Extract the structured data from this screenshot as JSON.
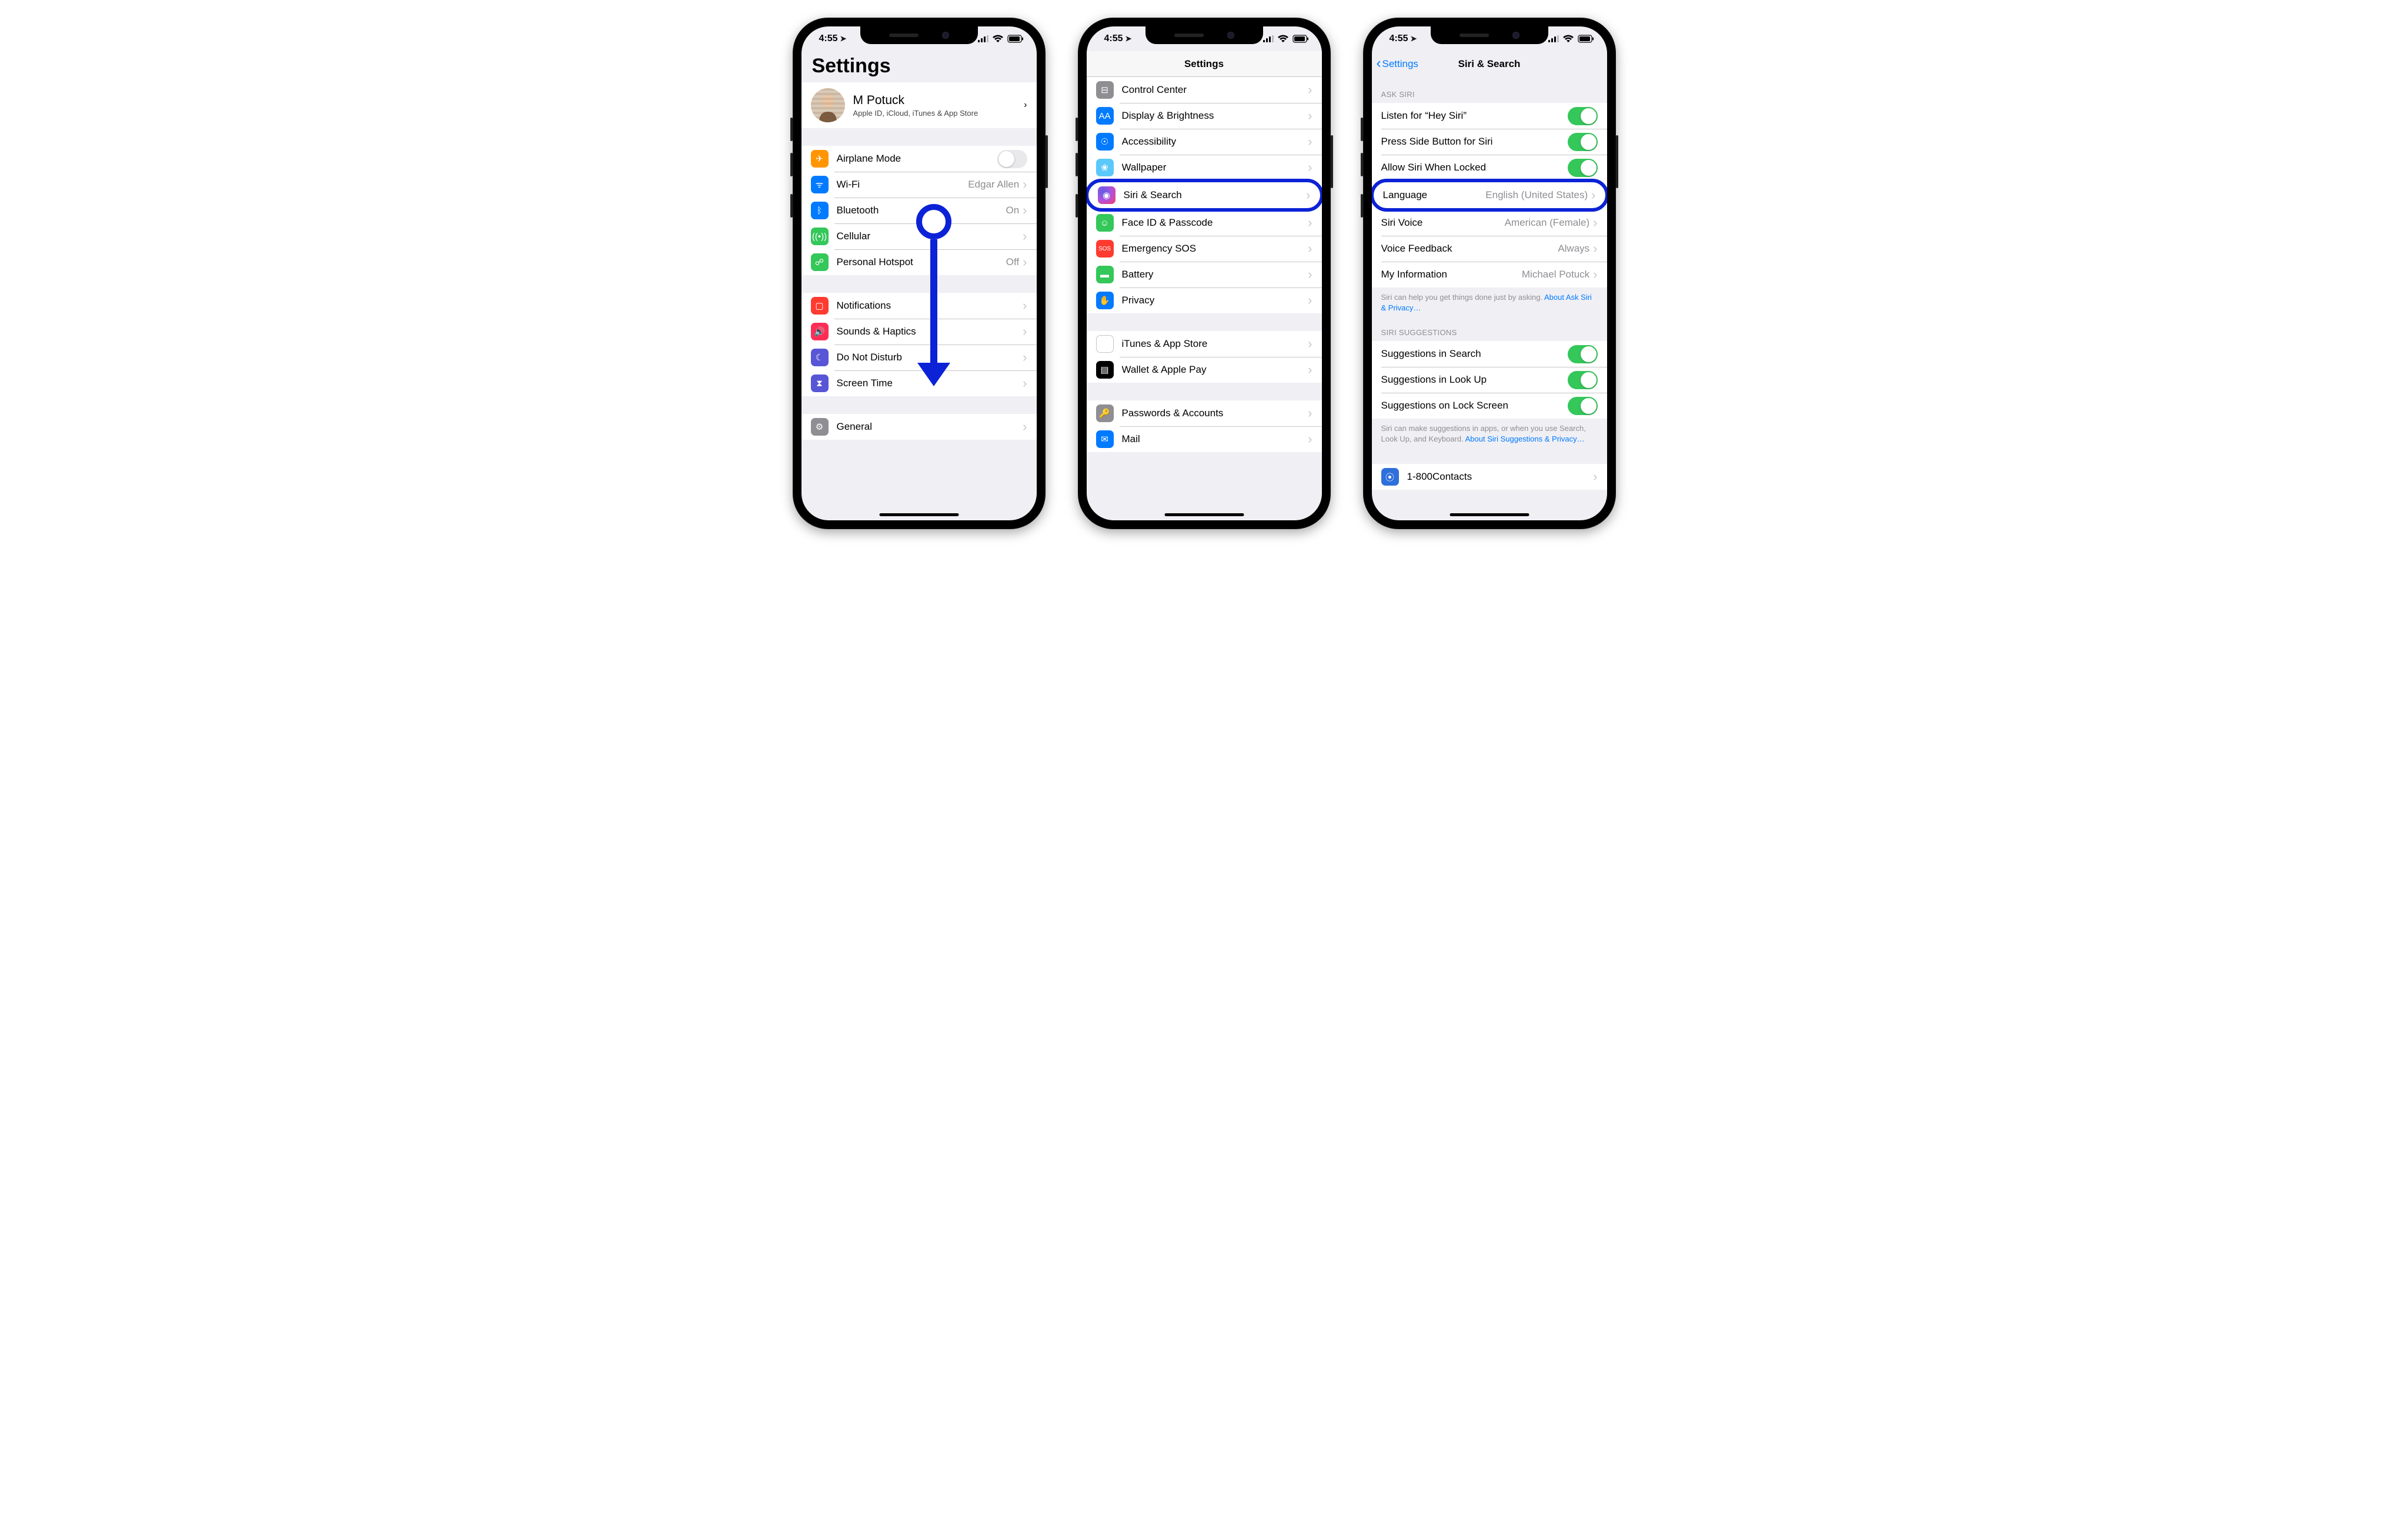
{
  "status": {
    "time": "4:55",
    "location_glyph": "➤",
    "battery_pct": 85
  },
  "phone1": {
    "title": "Settings",
    "profile": {
      "name": "M Potuck",
      "subtitle": "Apple ID, iCloud, iTunes & App Store"
    },
    "groups": [
      [
        {
          "icon": "airplane-icon",
          "color": "ic-orange",
          "glyph": "✈",
          "label": "Airplane Mode",
          "type": "switch",
          "on": false
        },
        {
          "icon": "wifi-icon",
          "color": "ic-blue",
          "glyph": "ᯤ",
          "label": "Wi-Fi",
          "value": "Edgar Allen",
          "type": "link"
        },
        {
          "icon": "bluetooth-icon",
          "color": "ic-blue",
          "glyph": "ᛒ",
          "label": "Bluetooth",
          "value": "On",
          "type": "link"
        },
        {
          "icon": "cellular-icon",
          "color": "ic-green",
          "glyph": "((•))",
          "label": "Cellular",
          "type": "link"
        },
        {
          "icon": "hotspot-icon",
          "color": "ic-green",
          "glyph": "☍",
          "label": "Personal Hotspot",
          "value": "Off",
          "type": "link"
        }
      ],
      [
        {
          "icon": "notifications-icon",
          "color": "ic-red",
          "glyph": "▢",
          "label": "Notifications",
          "type": "link"
        },
        {
          "icon": "sounds-icon",
          "color": "ic-pink",
          "glyph": "🔊",
          "label": "Sounds & Haptics",
          "type": "link"
        },
        {
          "icon": "dnd-icon",
          "color": "ic-purple",
          "glyph": "☾",
          "label": "Do Not Disturb",
          "type": "link"
        },
        {
          "icon": "screentime-icon",
          "color": "ic-purple",
          "glyph": "⧗",
          "label": "Screen Time",
          "type": "link"
        }
      ],
      [
        {
          "icon": "general-icon",
          "color": "ic-gray",
          "glyph": "⚙",
          "label": "General",
          "type": "link"
        }
      ]
    ]
  },
  "phone2": {
    "title": "Settings",
    "groups": [
      [
        {
          "icon": "control-center-icon",
          "color": "ic-gray",
          "glyph": "⊟",
          "label": "Control Center",
          "type": "link"
        },
        {
          "icon": "display-icon",
          "color": "ic-blue",
          "glyph": "AA",
          "label": "Display & Brightness",
          "type": "link"
        },
        {
          "icon": "accessibility-icon",
          "color": "ic-blue",
          "glyph": "☉",
          "label": "Accessibility",
          "type": "link"
        },
        {
          "icon": "wallpaper-icon",
          "color": "ic-cyan",
          "glyph": "❀",
          "label": "Wallpaper",
          "type": "link"
        },
        {
          "icon": "siri-icon",
          "color": "ic-siri",
          "glyph": "◉",
          "label": "Siri & Search",
          "type": "link",
          "highlight": true
        },
        {
          "icon": "faceid-icon",
          "color": "ic-green",
          "glyph": "☺",
          "label": "Face ID & Passcode",
          "type": "link"
        },
        {
          "icon": "sos-icon",
          "color": "ic-red",
          "glyph": "SOS",
          "label": "Emergency SOS",
          "type": "link",
          "small": true
        },
        {
          "icon": "battery-icon",
          "color": "ic-green",
          "glyph": "▬",
          "label": "Battery",
          "type": "link"
        },
        {
          "icon": "privacy-icon",
          "color": "ic-blue",
          "glyph": "✋",
          "label": "Privacy",
          "type": "link"
        }
      ],
      [
        {
          "icon": "appstore-icon",
          "color": "ic-white",
          "glyph": "",
          "label": "iTunes & App Store",
          "type": "link"
        },
        {
          "icon": "wallet-icon",
          "color": "ic-wallet",
          "glyph": "▤",
          "label": "Wallet & Apple Pay",
          "type": "link"
        }
      ],
      [
        {
          "icon": "passwords-icon",
          "color": "ic-gray",
          "glyph": "🔑",
          "label": "Passwords & Accounts",
          "type": "link"
        },
        {
          "icon": "mail-icon",
          "color": "ic-blue",
          "glyph": "✉",
          "label": "Mail",
          "type": "link"
        }
      ]
    ]
  },
  "phone3": {
    "title": "Siri & Search",
    "back": "Settings",
    "section1_header": "ASK SIRI",
    "section2_header": "SIRI SUGGESTIONS",
    "footer1a": "Siri can help you get things done just by asking. ",
    "footer1b": "About Ask Siri & Privacy…",
    "footer2a": "Siri can make suggestions in apps, or when you use Search, Look Up, and Keyboard. ",
    "footer2b": "About Siri Suggestions & Privacy…",
    "rows1": [
      {
        "label": "Listen for “Hey Siri”",
        "type": "switch",
        "on": true
      },
      {
        "label": "Press Side Button for Siri",
        "type": "switch",
        "on": true
      },
      {
        "label": "Allow Siri When Locked",
        "type": "switch",
        "on": true
      },
      {
        "label": "Language",
        "value": "English (United States)",
        "type": "link",
        "highlight": true
      },
      {
        "label": "Siri Voice",
        "value": "American (Female)",
        "type": "link"
      },
      {
        "label": "Voice Feedback",
        "value": "Always",
        "type": "link"
      },
      {
        "label": "My Information",
        "value": "Michael Potuck",
        "type": "link"
      }
    ],
    "rows2": [
      {
        "label": "Suggestions in Search",
        "type": "switch",
        "on": true
      },
      {
        "label": "Suggestions in Look Up",
        "type": "switch",
        "on": true
      },
      {
        "label": "Suggestions on Lock Screen",
        "type": "switch",
        "on": true
      }
    ],
    "app_row": {
      "icon": "1800contacts-icon",
      "color": "ic-1800",
      "glyph": "⦿",
      "label": "1-800Contacts",
      "type": "link"
    }
  }
}
